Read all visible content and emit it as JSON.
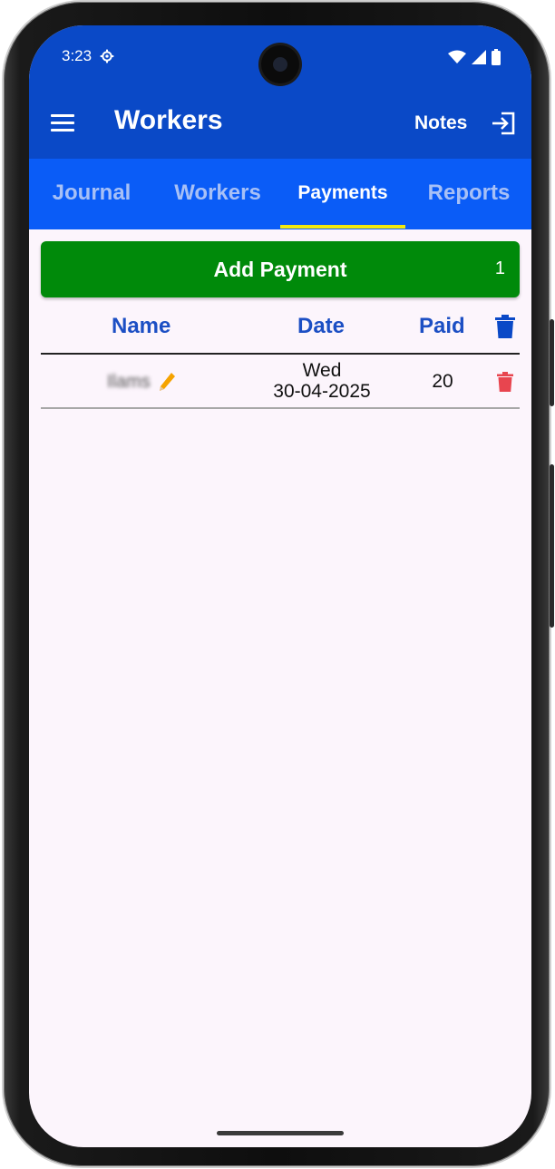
{
  "status_bar": {
    "time": "3:23"
  },
  "toolbar": {
    "title": "Workers",
    "notes_label": "Notes"
  },
  "tabs": [
    {
      "label": "Journal",
      "active": false
    },
    {
      "label": "Workers",
      "active": false
    },
    {
      "label": "Payments",
      "active": true
    },
    {
      "label": "Reports",
      "active": false
    }
  ],
  "add_payment": {
    "label": "Add Payment",
    "count": "1"
  },
  "table": {
    "headers": {
      "name": "Name",
      "date": "Date",
      "paid": "Paid"
    },
    "rows": [
      {
        "name": "Ilams",
        "day": "Wed",
        "date": "30-04-2025",
        "paid": "20"
      }
    ]
  },
  "colors": {
    "toolbar": "#0a49c7",
    "tab_bar": "#0a5cf7",
    "tab_indicator": "#f2e90e",
    "add_button": "#008a0a",
    "header_text": "#1c4fc4",
    "row_delete": "#e8454f",
    "background": "#fcf5fc"
  },
  "icons": {
    "menu": "hamburger-icon",
    "logout": "exit-icon",
    "edit": "pencil-icon",
    "delete_all": "trash-icon",
    "delete_row": "trash-icon"
  }
}
